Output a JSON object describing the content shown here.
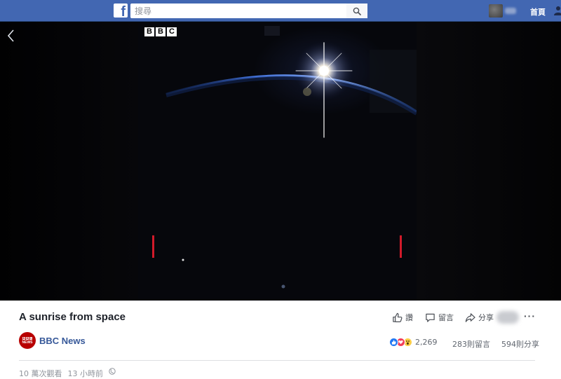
{
  "topbar": {
    "logo_letter": "f",
    "search_placeholder": "搜尋",
    "home_label": "首頁"
  },
  "video": {
    "channel_logo": [
      "B",
      "B",
      "C"
    ]
  },
  "post": {
    "title": "A sunrise from space",
    "page_name": "BBC News",
    "page_avatar_top": [
      "B",
      "B",
      "C"
    ],
    "page_avatar_bottom": "NEWS",
    "actions": {
      "like_label": "讚",
      "comment_label": "留言",
      "share_label": "分享"
    },
    "reaction_count": "2,269",
    "comments_count": "283則留言",
    "shares_count": "594則分享",
    "views": "10 萬次觀看",
    "time_ago": "13 小時前"
  },
  "colors": {
    "brand_blue": "#4267b2",
    "link_blue": "#365899",
    "like_blue": "#2078f4",
    "love_red": "#f33e58",
    "wow_yellow": "#fbcd46",
    "bbc_red": "#b80000"
  },
  "icons": [
    "facebook-logo-icon",
    "search-icon",
    "friends-icon",
    "back-arrow-icon",
    "like-icon",
    "comment-icon",
    "share-icon",
    "more-icon",
    "globe-icon",
    "like-reaction-icon",
    "love-reaction-icon",
    "wow-reaction-icon"
  ]
}
